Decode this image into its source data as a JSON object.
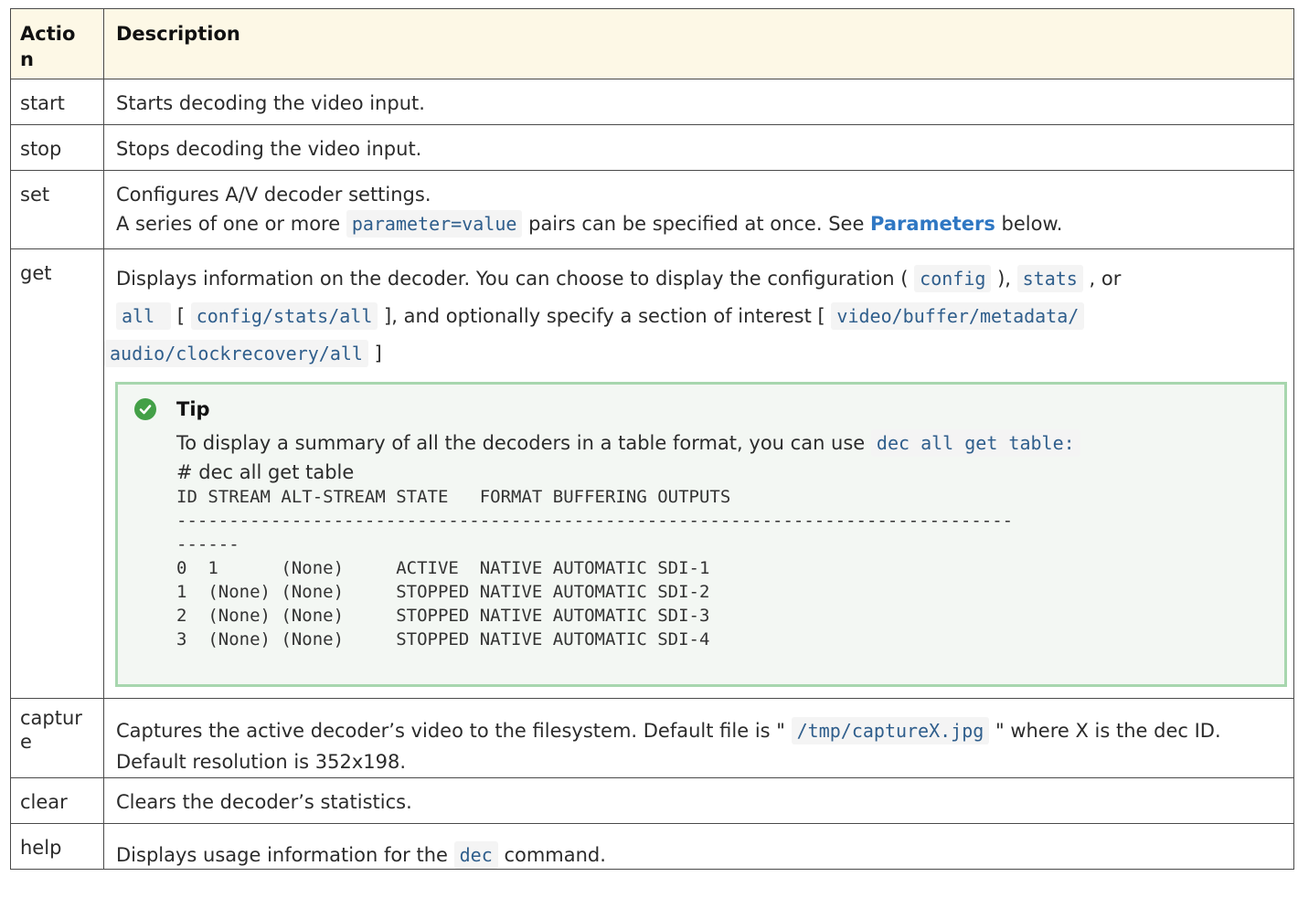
{
  "header": {
    "action": "Actio\nn",
    "description": "Description"
  },
  "rows": [
    {
      "action": "start",
      "description": "Starts decoding the video input."
    },
    {
      "action": "stop",
      "description": "Stops decoding the video input."
    },
    {
      "action": "set",
      "line1": "Configures A/V decoder settings.",
      "line2_pre": "A series of one or more ",
      "line2_code": "parameter=value",
      "line2_mid": " pairs can be specified at once. See ",
      "line2_link": "Parameters",
      "line2_post": " below."
    },
    {
      "action": "get",
      "t1": "Displays information on the decoder. You can choose to display the configuration ( ",
      "c1": "config",
      "t2": " ), ",
      "c2": "stats",
      "t3": " , or ",
      "c3": "all ",
      "t4": " [ ",
      "c4": "config/stats/all",
      "t5": " ], and optionally specify a section of interest [ ",
      "c5": "video/buffer/metadata/",
      "c6": "audio/clockrecovery/all",
      "t6": " ]",
      "tip": {
        "title": "Tip",
        "text": "To display a summary of all the decoders in a table format, you can use ",
        "code": "dec all get table:",
        "cmd": "# dec all get table",
        "output": "ID STREAM ALT-STREAM STATE   FORMAT BUFFERING OUTPUTS\n--------------------------------------------------------------------------------\n------\n0  1      (None)     ACTIVE  NATIVE AUTOMATIC SDI-1\n1  (None) (None)     STOPPED NATIVE AUTOMATIC SDI-2\n2  (None) (None)     STOPPED NATIVE AUTOMATIC SDI-3\n3  (None) (None)     STOPPED NATIVE AUTOMATIC SDI-4"
      }
    },
    {
      "action": "captur\ne",
      "t1": "Captures the active decoder’s video to the filesystem. Default file is \" ",
      "code": "/tmp/captureX.jpg",
      "t2": " \" where X is the dec ID. Default resolution is 352x198."
    },
    {
      "action": "clear",
      "description": "Clears the decoder’s statistics."
    },
    {
      "action": "help",
      "t1": "Displays usage information for the ",
      "code": "dec",
      "t2": " command."
    }
  ],
  "colors": {
    "header_bg": "#fdf8e6",
    "code_color": "#2f5e8c",
    "link_color": "#2f77c3",
    "tip_border": "#a7d6ae",
    "tip_icon": "#43a047"
  }
}
